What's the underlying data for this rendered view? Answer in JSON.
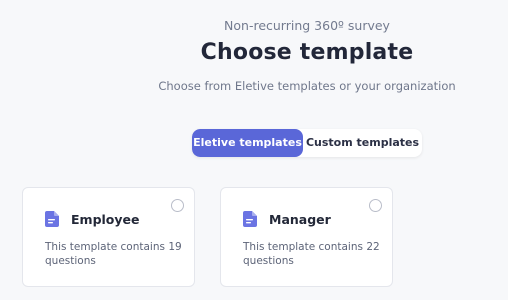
{
  "header": {
    "eyebrow": "Non-recurring 360º survey",
    "title": "Choose template",
    "subtitle": "Choose from Eletive templates or your organization"
  },
  "tabs": [
    {
      "label": "Eletive templates",
      "active": true
    },
    {
      "label": "Custom templates",
      "active": false
    }
  ],
  "templates": [
    {
      "title": "Employee",
      "description": "This template contains 19 questions",
      "icon": "document-icon",
      "selected": false
    },
    {
      "title": "Manager",
      "description": "This template contains 22 questions",
      "icon": "document-icon",
      "selected": false
    }
  ],
  "colors": {
    "accent": "#5a67d8",
    "icon": "#6b74e3"
  }
}
